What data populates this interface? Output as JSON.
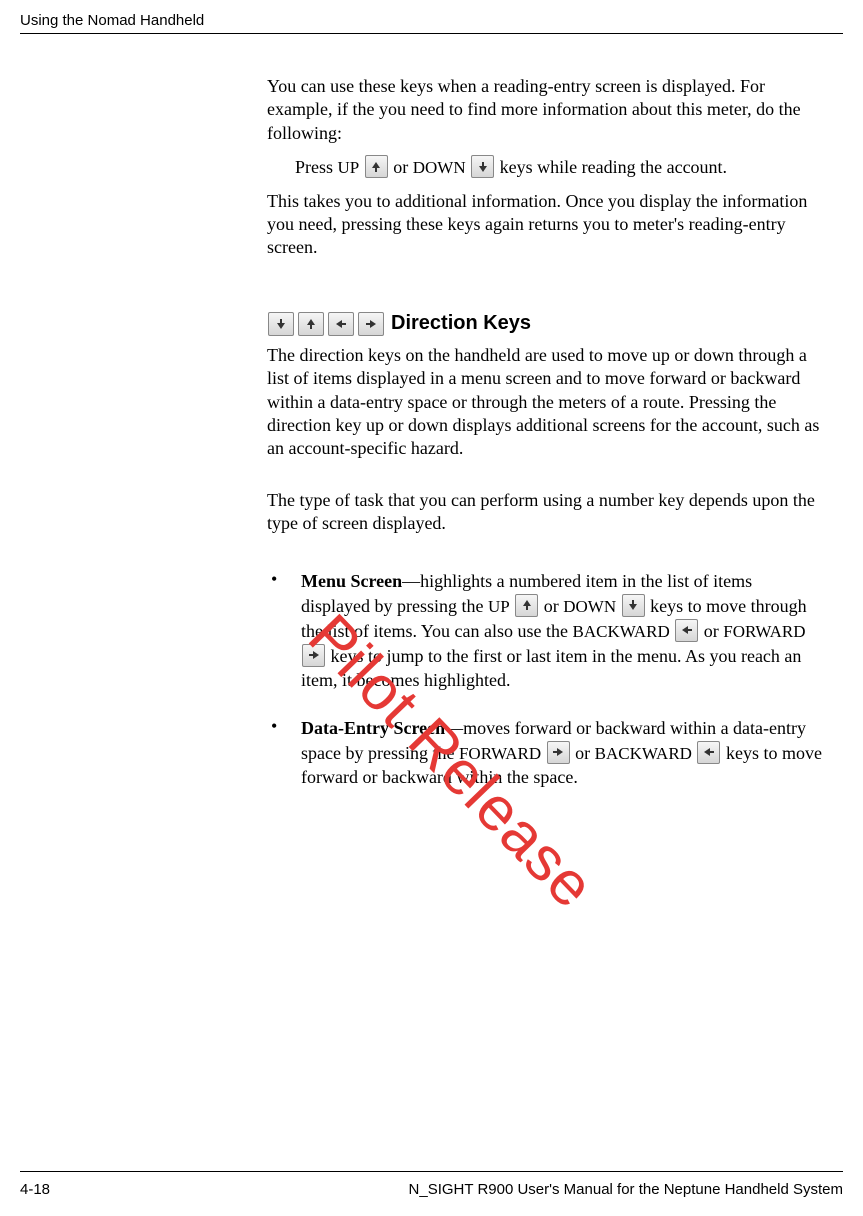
{
  "header": {
    "left": "Using the Nomad Handheld",
    "right": ""
  },
  "intro": {
    "p1": "You can use these keys when a reading-entry screen is displayed. For example, if the you need to find more information about this meter, do the following:",
    "press_line_pre": "Press ",
    "press_line_up": "UP",
    "press_line_or": " or ",
    "press_line_down": "DOWN",
    "press_line_post": " keys while reading the account.",
    "p2": "This takes you to additional information. Once you display the information you need, pressing these keys again returns you to meter's reading-entry screen."
  },
  "section": {
    "heading": "Direction Keys",
    "p1": "The direction keys on the handheld are used to move up or down through a list of items displayed in a menu screen and to move forward or backward within a data-entry space or through the meters of a route. Pressing the direction key up or down displays additional screens for the account, such as an account-specific hazard.",
    "p2": "The type of task that you can perform using a number key depends upon the type of screen displayed."
  },
  "bullets": {
    "menu": {
      "title": "Menu Screen",
      "t1": "—highlights a numbered item in the list of items displayed by pressing the ",
      "up": "UP",
      "t2": " or ",
      "down": "DOWN",
      "t3": " keys to move through the list of items. You can also use the ",
      "backward": "BACKWARD",
      "t4": " or ",
      "forward": "FORWARD",
      "t5": " keys to jump to the first or last item in the menu. As you reach an item, it becomes highlighted."
    },
    "data": {
      "title": "Data-Entry Screen",
      "t1": "—moves forward or backward within a data-entry space by pressing the ",
      "forward": "FORWARD",
      "t2": " or ",
      "backward": "BACKWARD",
      "t3": " keys to move forward or backward within the space."
    }
  },
  "watermark": "Pilot Release",
  "footer": {
    "pageno": "4-18",
    "title": "N_SIGHT R900 User's Manual for the Neptune Handheld System"
  }
}
